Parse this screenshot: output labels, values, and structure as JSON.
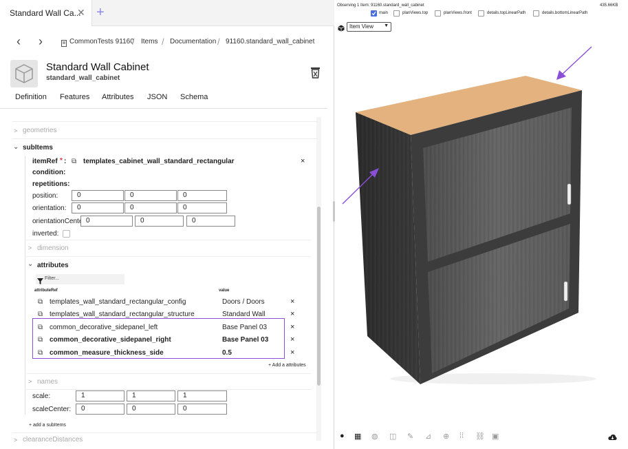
{
  "tab": {
    "title": "Standard Wall Ca...",
    "close": "✕",
    "add": "+"
  },
  "nav": {
    "back": "‹",
    "forward": "›"
  },
  "breadcrumb": [
    "CommonTests 91160",
    "Items",
    "Documentation",
    "91160.standard_wall_cabinet"
  ],
  "breadcrumb_sep": "/",
  "header": {
    "title": "Standard Wall Cabinet",
    "subtitle": "standard_wall_cabinet"
  },
  "panel_tabs": [
    "Definition",
    "Features",
    "Attributes",
    "JSON",
    "Schema"
  ],
  "tree": {
    "geometries": "geometries",
    "subitems": "subItems",
    "itemref_label": "itemRef",
    "itemref_required": "*",
    "itemref_colon": ":",
    "itemref_value": "templates_cabinet_wall_standard_rectangular",
    "condition": "condition:",
    "repetitions": "repetitions:",
    "position_label": "position:",
    "position": [
      "0",
      "0",
      "0"
    ],
    "orientation_label": "orientation:",
    "orientation": [
      "0",
      "0",
      "0"
    ],
    "orientation_center_label": "orientationCente",
    "orientation_center": [
      "0",
      "0",
      "0"
    ],
    "inverted_label": "inverted:",
    "dimension": "dimension",
    "attributes": "attributes",
    "filter_placeholder": "Filter...",
    "col_attributeref": "attributeRef",
    "col_value": "value",
    "attribute_rows": [
      {
        "name": "templates_wall_standard_rectangular_config",
        "value": "Doors / Doors",
        "bold": false
      },
      {
        "name": "templates_wall_standard_rectangular_structure",
        "value": "Standard Wall",
        "bold": false
      },
      {
        "name": "common_decorative_sidepanel_left",
        "value": "Base Panel 03",
        "bold": false
      },
      {
        "name": "common_decorative_sidepanel_right",
        "value": "Base Panel 03",
        "bold": true
      },
      {
        "name": "common_measure_thickness_side",
        "value": "0.5",
        "bold": true
      }
    ],
    "add_attributes": "+ Add a attributes",
    "names": "names",
    "scale_label": "scale:",
    "scale": [
      "1",
      "1",
      "1"
    ],
    "scale_center_label": "scaleCenter:",
    "scale_center": [
      "0",
      "0",
      "0"
    ],
    "add_subitems": "+ add a subItems",
    "clearance": "clearanceDistances",
    "remove": "×"
  },
  "viewer": {
    "observing": "Observing 1 Item: 91160.standard_wall_cabinet",
    "size": "435.66KB",
    "layers": [
      {
        "label": "main",
        "checked": true
      },
      {
        "label": "planViews.top",
        "checked": false
      },
      {
        "label": "planViews.front",
        "checked": false
      },
      {
        "label": "details.topLinearPath",
        "checked": false
      },
      {
        "label": "details.bottomLinearPath",
        "checked": false
      }
    ],
    "view_mode": "Item View",
    "colors": {
      "accent": "#8a4fd6",
      "wood_top": "#e3b27e",
      "door": "#5a5a5a",
      "side": "#2f2f2f"
    }
  }
}
